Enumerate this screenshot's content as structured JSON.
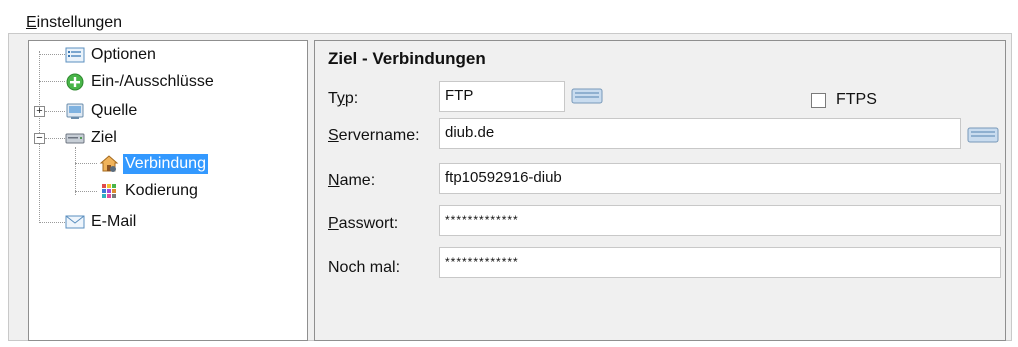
{
  "group": {
    "title_first": "E",
    "title_rest": "instellungen"
  },
  "tree": {
    "items": [
      {
        "label": "Optionen",
        "icon": "options-list-icon"
      },
      {
        "label": "Ein-/Ausschlüsse",
        "icon": "add-green-icon"
      },
      {
        "label": "Quelle",
        "icon": "source-icon",
        "expander": "+"
      },
      {
        "label": "Ziel",
        "icon": "server-icon",
        "expander": "−"
      },
      {
        "label": "Verbindung",
        "icon": "connection-house-icon",
        "selected": true
      },
      {
        "label": "Kodierung",
        "icon": "encoding-grid-icon"
      },
      {
        "label": "E-Mail",
        "icon": "email-envelope-icon"
      }
    ]
  },
  "panel": {
    "title": "Ziel - Verbindungen",
    "typ": {
      "label_u": "y",
      "label_pre": "T",
      "label_post": "p:",
      "value": "FTP"
    },
    "ftps": {
      "label": "FTPS",
      "checked": false
    },
    "servername": {
      "label_u": "S",
      "label_rest": "ervername:",
      "value": "diub.de"
    },
    "name": {
      "label_u": "N",
      "label_rest": "ame:",
      "value": "ftp10592916-diub"
    },
    "passwort": {
      "label_u": "P",
      "label_rest": "asswort:",
      "value": "*************"
    },
    "nochmal": {
      "label": "Noch mal:",
      "value": "*************"
    }
  },
  "colors": {
    "selection": "#3399ff",
    "background": "#f0f0f0"
  }
}
